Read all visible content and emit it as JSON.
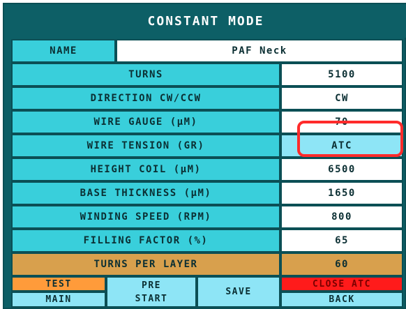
{
  "header": {
    "title": "CONSTANT MODE"
  },
  "name_row": {
    "label": "NAME",
    "value": "PAF Neck"
  },
  "params": [
    {
      "label": "TURNS",
      "value": "5100"
    },
    {
      "label": "DIRECTION CW/CCW",
      "value": "CW"
    },
    {
      "label": "WIRE GAUGE (µM)",
      "value": "70"
    },
    {
      "label": "WIRE TENSION (GR)",
      "value": "ATC"
    },
    {
      "label": "HEIGHT COIL (µM)",
      "value": "6500"
    },
    {
      "label": "BASE THICKNESS (µM)",
      "value": "1650"
    },
    {
      "label": "WINDING SPEED (RPM)",
      "value": "800"
    },
    {
      "label": "FILLING FACTOR (%)",
      "value": "65"
    },
    {
      "label": "TURNS PER LAYER",
      "value": "60"
    }
  ],
  "buttons": {
    "test": "TEST",
    "main": "MAIN",
    "pre_start_line1": "PRE",
    "pre_start_line2": "START",
    "save": "SAVE",
    "close_atc": "CLOSE ATC",
    "back": "BACK"
  },
  "colors": {
    "panel": "#0d5f66",
    "cyan": "#39cfdb",
    "tan": "#d8a04d",
    "light_blue": "#8ee5f6",
    "orange": "#ff9b3a",
    "red": "#ff1b1b",
    "highlight": "#ff2b2b"
  }
}
